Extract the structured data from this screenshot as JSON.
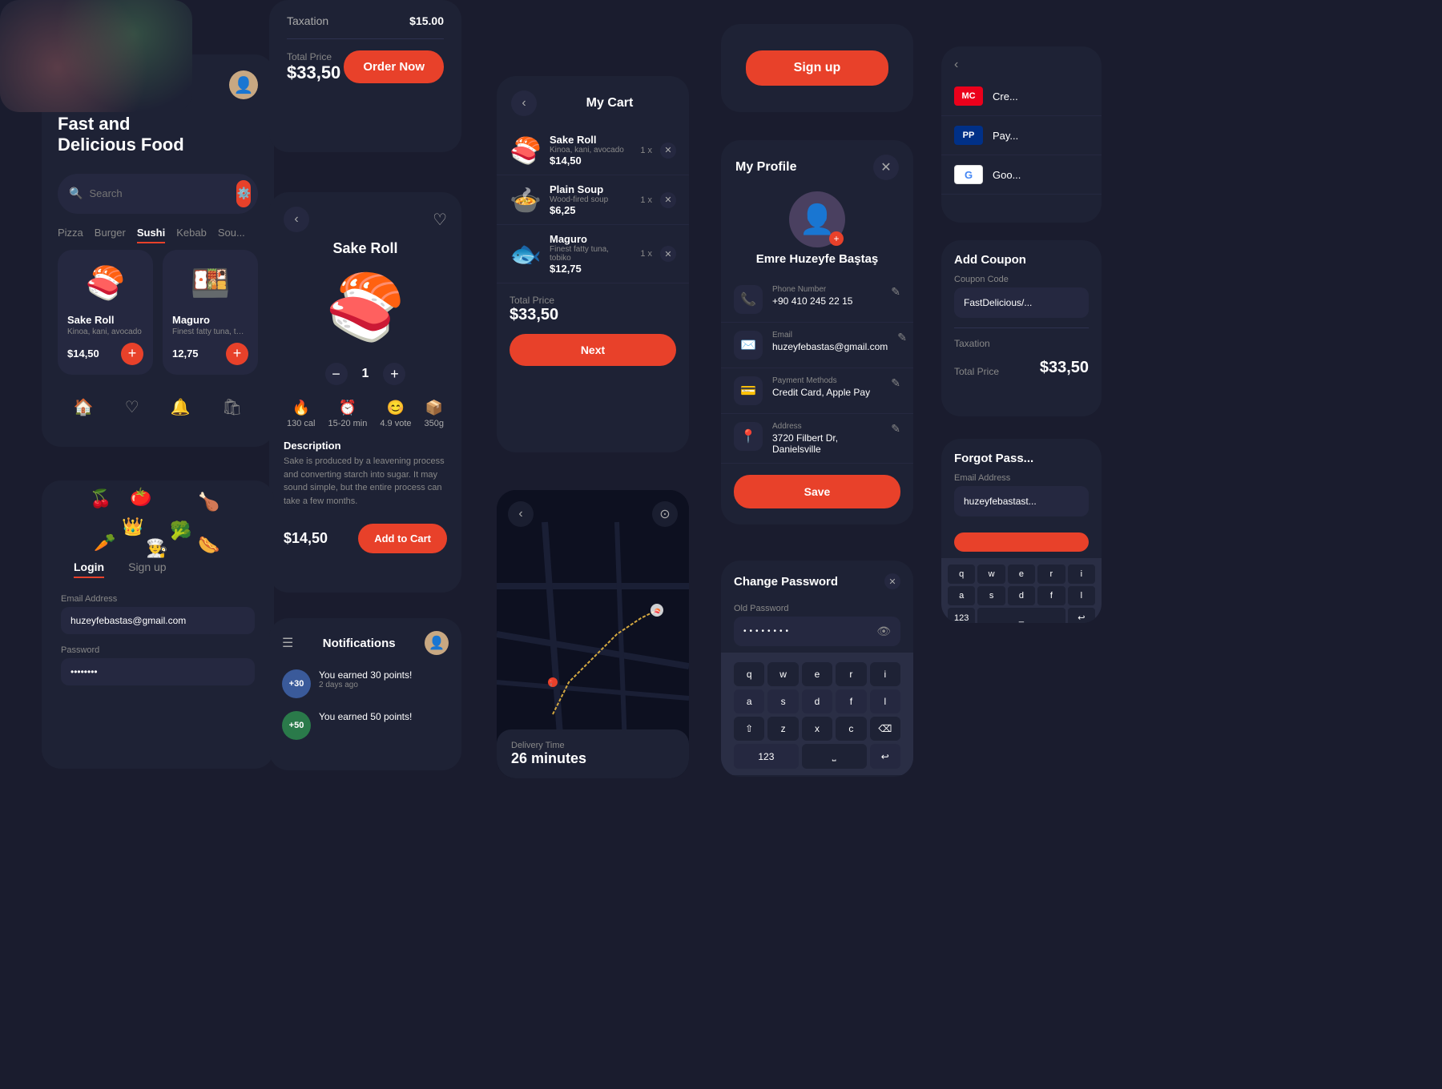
{
  "app": {
    "title": "Fast and Delicious Food"
  },
  "main_card": {
    "title_line1": "Fast and",
    "title_line2": "Delicious Food",
    "search_placeholder": "Search",
    "categories": [
      "Pizza",
      "Burger",
      "Sushi",
      "Kebab",
      "Sou..."
    ],
    "active_category": "Sushi",
    "foods": [
      {
        "name": "Sake Roll",
        "desc": "Kinoa, kani, avocado",
        "price": "$14,50",
        "emoji": "🍣"
      },
      {
        "name": "Maguro",
        "desc": "Finest fatty tuna, tobi...",
        "price": "12,75",
        "emoji": "🍱"
      }
    ],
    "nav_items": [
      "home",
      "heart",
      "bell",
      "bag"
    ]
  },
  "order_card": {
    "taxation_label": "Taxation",
    "taxation_value": "$15.00",
    "total_label": "Total Price",
    "total_price": "$33,50",
    "order_now_label": "Order Now"
  },
  "detail_card": {
    "food_name": "Sake Roll",
    "food_emoji": "🍣",
    "quantity": "1",
    "stats": [
      {
        "icon": "🔥",
        "value": "130 cal"
      },
      {
        "icon": "⏰",
        "value": "15-20 min"
      },
      {
        "icon": "😊",
        "value": "4.9 vote"
      },
      {
        "icon": "📦",
        "value": "350g"
      }
    ],
    "description_title": "Description",
    "description_text": "Sake is produced by a leavening process and converting starch into sugar. It may sound simple, but the entire process can take a few months.",
    "price": "$14,50",
    "add_to_cart_label": "Add to Cart"
  },
  "cart_card": {
    "title": "My Cart",
    "items": [
      {
        "name": "Sake Roll",
        "desc": "Kinoa, kani, avocado",
        "qty": "1 x",
        "price": "$14,50",
        "emoji": "🍣"
      },
      {
        "name": "Plain Soup",
        "desc": "Wood-fired soup",
        "qty": "1 x",
        "price": "$6,25",
        "emoji": "🍲"
      },
      {
        "name": "Maguro",
        "desc": "Finest fatty tuna, tobiko",
        "qty": "1 x",
        "price": "$12,75",
        "emoji": "🐟"
      }
    ],
    "total_label": "Total Price",
    "total_price": "$33,50",
    "next_label": "Next"
  },
  "profile_card": {
    "title": "My Profile",
    "name": "Emre Huzeyfe Baştaş",
    "fields": [
      {
        "icon": "📞",
        "label": "Phone Number",
        "value": "+90 410 245 22 15"
      },
      {
        "icon": "✉️",
        "label": "Email",
        "value": "huzeyfebastas@gmail.com"
      },
      {
        "icon": "💳",
        "label": "Payment Methods",
        "value": "Credit Card, Apple Pay"
      },
      {
        "icon": "📍",
        "label": "Address",
        "value": "3720 Filbert Dr, Danielsville"
      }
    ],
    "save_label": "Save"
  },
  "signup_card": {
    "signup_label": "Sign up"
  },
  "login_card": {
    "tabs": [
      "Login",
      "Sign up"
    ],
    "active_tab": "Login",
    "email_label": "Email Address",
    "email_value": "huzeyfebastas@gmail.com",
    "password_label": "Password",
    "password_value": "••••••••"
  },
  "notif_card": {
    "title": "Notifications",
    "items": [
      {
        "badge": "+30",
        "text": "You earned 30 points!",
        "sub": "2 days ago",
        "color": "blue"
      },
      {
        "badge": "+50",
        "text": "You earned 50 points!",
        "sub": "",
        "color": "green"
      }
    ]
  },
  "map_card": {
    "delivery_label": "Delivery Time",
    "delivery_time": "26 minutes"
  },
  "change_pw_card": {
    "title": "Change Password",
    "old_pw_label": "Old Password",
    "old_pw_value": "••••••••",
    "keyboard_rows": [
      [
        "q",
        "w",
        "e",
        "r",
        "i"
      ],
      [
        "a",
        "s",
        "d",
        "f",
        "l"
      ],
      [
        "⇧",
        "z",
        "x",
        "c",
        "⌫"
      ],
      [
        "123",
        "space",
        "return"
      ]
    ]
  },
  "payment_card": {
    "items": [
      {
        "logo": "💳",
        "name": "Cre...",
        "partial": ""
      },
      {
        "logo": "🅿️",
        "name": "Pay...",
        "partial": ""
      },
      {
        "logo": "G",
        "name": "Goo...",
        "partial": ""
      }
    ]
  },
  "coupon_card": {
    "title": "Add Coupon",
    "coupon_label": "Coupon Code",
    "coupon_value": "FastDelicious/...",
    "taxation_label": "Taxation",
    "total_label": "Total Price",
    "total_price": "$33,50"
  },
  "forgot_pw_card": {
    "title": "Forgot Pass...",
    "email_label": "Email Address",
    "email_value": "huzeyfebastast...",
    "button_label": "···"
  }
}
